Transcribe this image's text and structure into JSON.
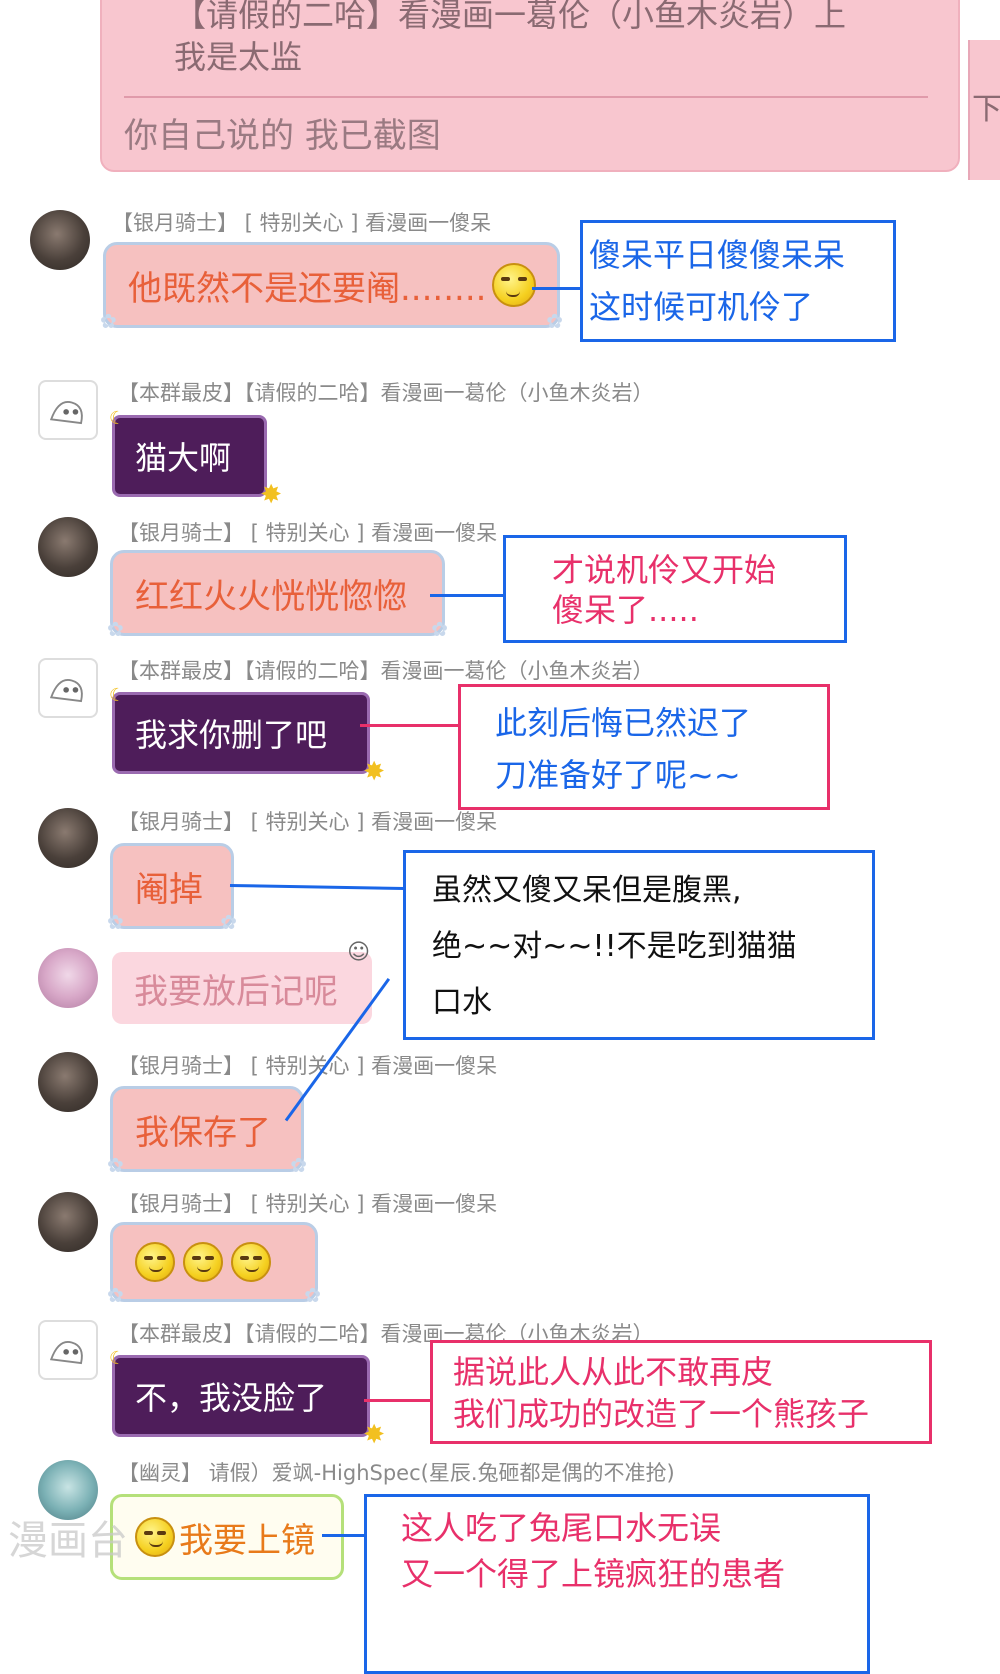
{
  "top_message": {
    "line1": "【请假的二哈】看漫画一葛伦（小鱼木炎岩）上",
    "line2": "我是太监",
    "reply": "你自己说的  我已截图",
    "right_sliver_char": "下"
  },
  "messages": [
    {
      "name": "【银月骑士】 [ 特别关心 ] 看漫画一傻呆",
      "text": "他既然不是还要阉........"
    },
    {
      "name": "【本群最皮】【请假的二哈】看漫画一葛伦（小鱼木炎岩）",
      "text": "猫大啊"
    },
    {
      "name": "【银月骑士】 [ 特别关心 ] 看漫画一傻呆",
      "text": "红红火火恍恍惚惚"
    },
    {
      "name": "【本群最皮】【请假的二哈】看漫画一葛伦（小鱼木炎岩）",
      "text": "我求你删了吧"
    },
    {
      "name": "【银月骑士】 [ 特别关心 ] 看漫画一傻呆",
      "text": "阉掉"
    },
    {
      "name": "",
      "text": "我要放后记呢"
    },
    {
      "name": "【银月骑士】 [ 特别关心 ] 看漫画一傻呆",
      "text": "我保存了"
    },
    {
      "name": "【银月骑士】 [ 特别关心 ] 看漫画一傻呆",
      "text": ""
    },
    {
      "name": "【本群最皮】【请假的二哈】看漫画一葛伦（小鱼木炎岩）",
      "text": "不，我没脸了"
    },
    {
      "name": "【幽灵】 请假）爱飒-HighSpec(星辰.兔砸都是偶的不准抢)",
      "text": "我要上镜"
    }
  ],
  "annotations": {
    "note1": [
      "傻呆平日傻傻呆呆",
      "这时候可机伶了"
    ],
    "note2": [
      "才说机伶又开始",
      "傻呆了....."
    ],
    "note3": [
      "此刻后悔已然迟了",
      "刀准备好了呢~~"
    ],
    "note4": [
      "虽然又傻又呆但是腹黑,",
      "绝~~对~~!!不是吃到猫猫",
      "口水"
    ],
    "note5": [
      "据说此人从此不敢再皮",
      "我们成功的改造了一个熊孩子"
    ],
    "note6": [
      "这人吃了兔尾口水无误",
      "又一个得了上镜疯狂的患者"
    ]
  },
  "watermark": "漫画台",
  "colors": {
    "note_blue": "#1a66e8",
    "note_magenta": "#e8306a",
    "bubble_pink": "#f6c1c0",
    "bubble_purple": "#4e1d5a",
    "pink_text": "#e8603a"
  },
  "icons": [
    "smiley-face-icon",
    "star-icon",
    "moon-icon",
    "bunny-corner-icon",
    "laughing-face-icon"
  ]
}
